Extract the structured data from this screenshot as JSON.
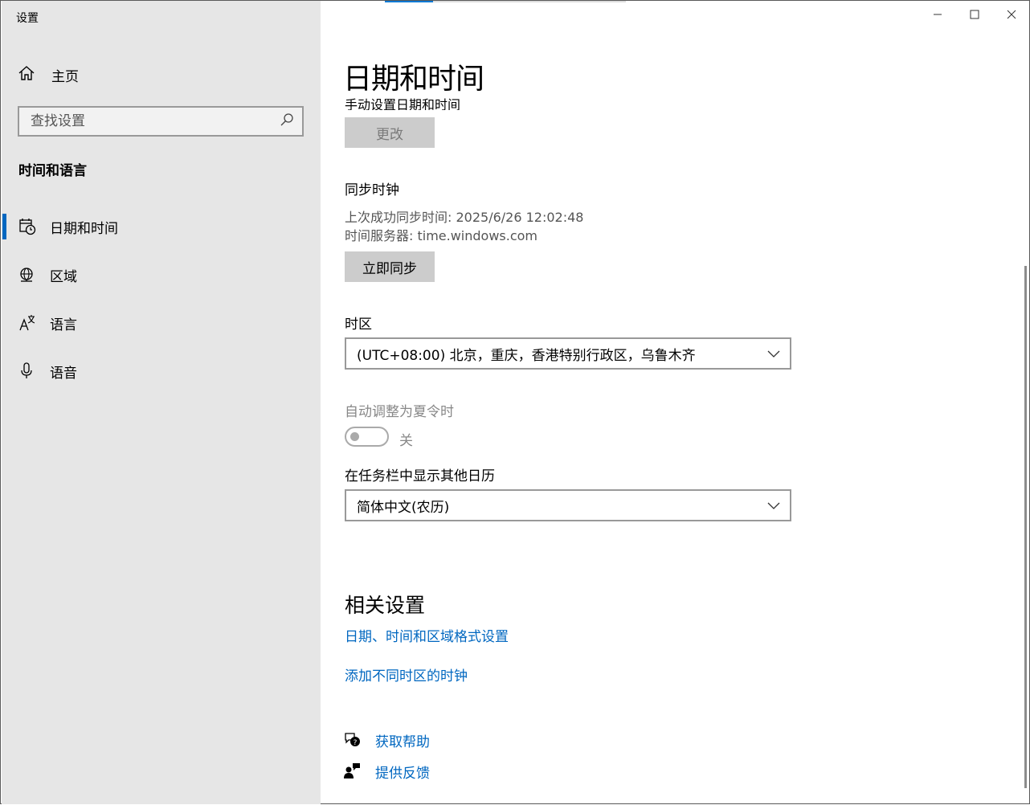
{
  "app": {
    "title": "设置"
  },
  "sidebar": {
    "home_label": "主页",
    "search_placeholder": "查找设置",
    "section_title": "时间和语言",
    "items": [
      {
        "label": "日期和时间",
        "icon": "calendar-clock-icon",
        "active": true
      },
      {
        "label": "区域",
        "icon": "globe-icon",
        "active": false
      },
      {
        "label": "语言",
        "icon": "language-icon",
        "active": false
      },
      {
        "label": "语音",
        "icon": "microphone-icon",
        "active": false
      }
    ]
  },
  "main": {
    "page_title": "日期和时间",
    "manual_set_label": "手动设置日期和时间",
    "change_button": "更改",
    "sync": {
      "heading": "同步时钟",
      "last_sync": "上次成功同步时间: 2025/6/26 12:02:48",
      "server": "时间服务器: time.windows.com",
      "sync_button": "立即同步"
    },
    "timezone": {
      "label": "时区",
      "value": "(UTC+08:00) 北京，重庆，香港特别行政区，乌鲁木齐"
    },
    "dst": {
      "label": "自动调整为夏令时",
      "state": "关"
    },
    "calendar": {
      "label": "在任务栏中显示其他日历",
      "value": "简体中文(农历)"
    },
    "related": {
      "heading": "相关设置",
      "links": [
        "日期、时间和区域格式设置",
        "添加不同时区的时钟"
      ]
    },
    "help": {
      "get_help": "获取帮助",
      "feedback": "提供反馈"
    }
  },
  "colors": {
    "accent": "#0067c0",
    "sidebar_bg": "#e6e6e6",
    "button_bg": "#cccccc"
  }
}
